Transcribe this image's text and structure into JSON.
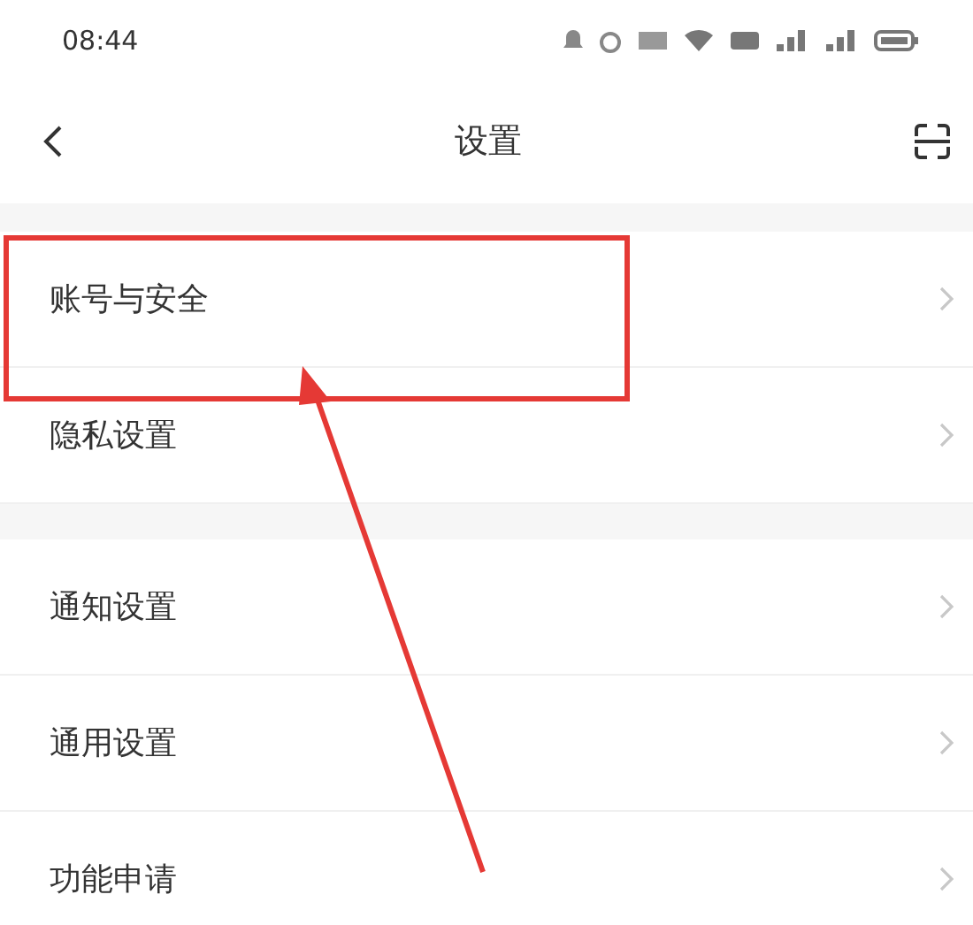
{
  "status_bar": {
    "time": "08:44"
  },
  "header": {
    "title": "设置"
  },
  "sections": [
    {
      "items": [
        {
          "label": "账号与安全",
          "highlighted": true
        },
        {
          "label": "隐私设置",
          "highlighted": false
        }
      ]
    },
    {
      "items": [
        {
          "label": "通知设置",
          "highlighted": false
        },
        {
          "label": "通用设置",
          "highlighted": false
        },
        {
          "label": "功能申请",
          "highlighted": false
        }
      ]
    }
  ]
}
